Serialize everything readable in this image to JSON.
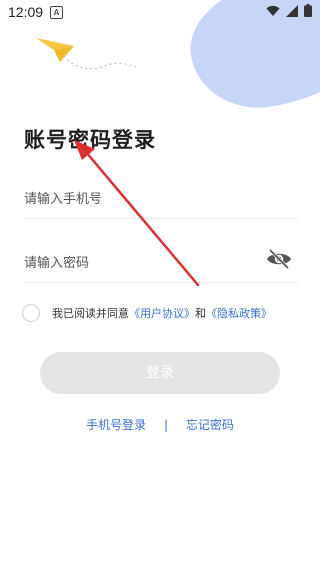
{
  "status_bar": {
    "time": "12:09",
    "notification_icon": "A"
  },
  "page": {
    "title": "账号密码登录"
  },
  "form": {
    "phone_placeholder": "请输入手机号",
    "password_placeholder": "请输入密码"
  },
  "agreement": {
    "prefix": "我已阅读并同意",
    "user_agreement": "《用户协议》",
    "and": "和",
    "privacy_policy": "《隐私政策》"
  },
  "login_button": {
    "label": "登录"
  },
  "bottom_links": {
    "phone_login": "手机号登录",
    "separator": "|",
    "forgot_password": "忘记密码"
  },
  "colors": {
    "accent": "#3a6fd0",
    "button_disabled": "#e4e4e4",
    "blob": "#c7d5f6",
    "arrow": "#d93030"
  },
  "icons": [
    "paper-plane-icon",
    "eye-off-icon",
    "wifi-icon",
    "signal-icon",
    "battery-icon"
  ]
}
